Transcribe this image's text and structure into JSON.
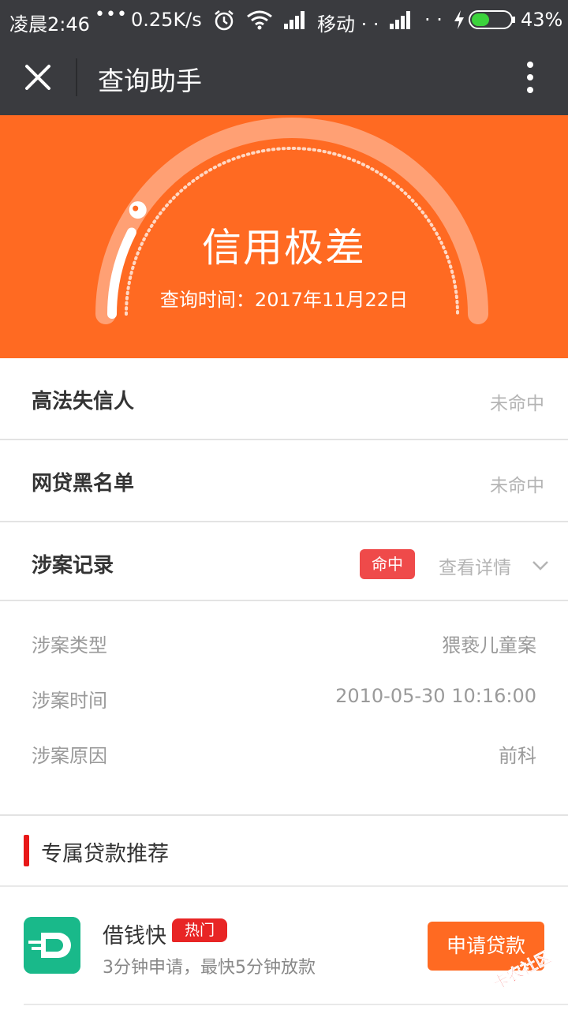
{
  "status_bar": {
    "time": "凌晨2:46",
    "dots": "•••",
    "speed": "0.25K/s",
    "carrier": "移动 · ·",
    "dots2": "· ·",
    "battery": "43%"
  },
  "title_bar": {
    "title": "查询助手"
  },
  "credit": {
    "rating": "信用极差",
    "query_time": "查询时间：2017年11月22日",
    "score_fraction": 0.15,
    "colors": {
      "bg": "#ff6a22",
      "track": "#ffa074",
      "fill": "#ffffff"
    }
  },
  "checks": [
    {
      "label": "高法失信人",
      "status": "未命中"
    },
    {
      "label": "网贷黑名单",
      "status": "未命中"
    },
    {
      "label": "涉案记录",
      "badge": "命中",
      "link": "查看详情"
    }
  ],
  "case_details": [
    {
      "key": "涉案类型",
      "value": "猥亵儿童案"
    },
    {
      "key": "涉案时间",
      "value": "2010-05-30 10:16:00"
    },
    {
      "key": "涉案原因",
      "value": "前科"
    }
  ],
  "loans": {
    "section_title": "专属贷款推荐",
    "items": [
      {
        "name": "借钱快",
        "tag": "热门",
        "desc": "3分钟申请，最快5分钟放款",
        "button": "申请贷款"
      }
    ]
  },
  "watermark": "卡农社区"
}
